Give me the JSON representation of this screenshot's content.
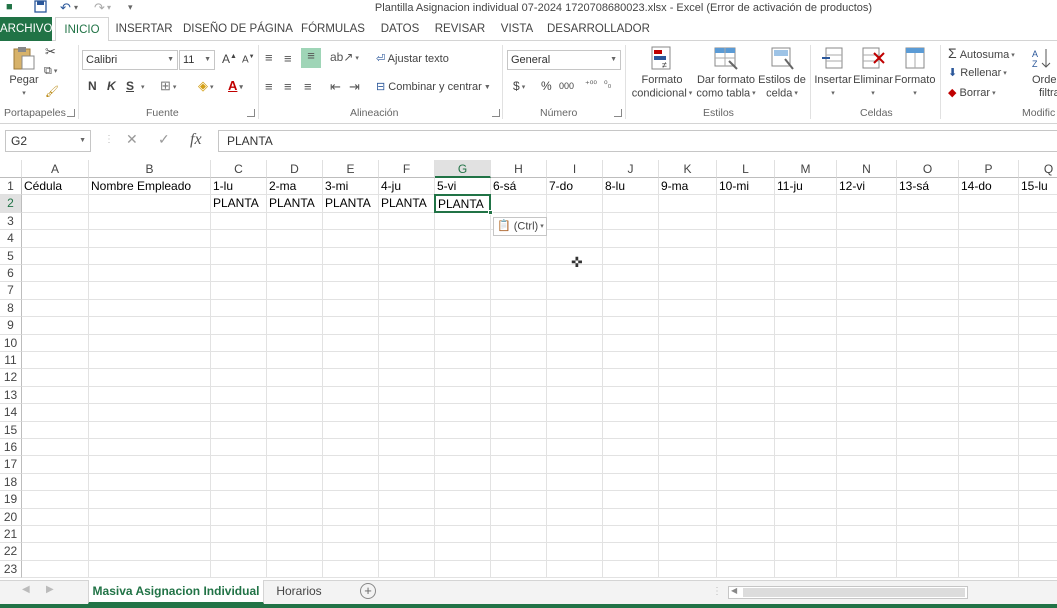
{
  "window": {
    "title": "Plantilla Asignacion individual 07-2024 1720708680023.xlsx - Excel (Error de activación de productos)"
  },
  "quick_access": {
    "save_icon": "save-icon",
    "undo_icon": "undo-icon",
    "redo_icon": "redo-icon",
    "customize_icon": "customize-icon"
  },
  "tabs": [
    "ARCHIVO",
    "INICIO",
    "INSERTAR",
    "DISEÑO DE PÁGINA",
    "FÓRMULAS",
    "DATOS",
    "REVISAR",
    "VISTA",
    "DESARROLLADOR"
  ],
  "ribbon": {
    "paste_label": "Pegar",
    "font_name": "Calibri",
    "font_size": "11",
    "bold": "N",
    "italic": "K",
    "underline": "S",
    "wrap_text": "Ajustar texto",
    "merge_center": "Combinar y centrar",
    "number_format": "General",
    "currency": "$",
    "percent": "%",
    "thousands": "000",
    "cond_format": [
      "Formato",
      "condicional"
    ],
    "format_table": [
      "Dar formato",
      "como tabla"
    ],
    "cell_styles": [
      "Estilos de",
      "celda"
    ],
    "insert": "Insertar",
    "delete": "Eliminar",
    "format": "Formato",
    "autosum": "Autosuma",
    "fill": "Rellenar",
    "clear": "Borrar",
    "sort_partial": [
      "Orden",
      "filtra"
    ],
    "groups": {
      "clipboard": "Portapapeles",
      "font": "Fuente",
      "alignment": "Alineación",
      "number": "Número",
      "styles": "Estilos",
      "cells": "Celdas",
      "modify": "Modific"
    }
  },
  "formula_bar": {
    "name_box": "G2",
    "fx": "fx",
    "value": "PLANTA"
  },
  "grid": {
    "columns": [
      "A",
      "B",
      "C",
      "D",
      "E",
      "F",
      "G",
      "H",
      "I",
      "J",
      "K",
      "L",
      "M",
      "N",
      "O",
      "P",
      "Q"
    ],
    "selected_column": "G",
    "rows": [
      "1",
      "2",
      "3",
      "4",
      "5",
      "6",
      "7",
      "8",
      "9",
      "10",
      "11",
      "12",
      "13",
      "14",
      "15",
      "16",
      "17",
      "18",
      "19",
      "20",
      "21",
      "22",
      "23"
    ],
    "selected_row": "2",
    "row1": [
      "Cédula",
      "Nombre Empleado",
      "1-lu",
      "2-ma",
      "3-mi",
      "4-ju",
      "5-vi",
      "6-sá",
      "7-do",
      "8-lu",
      "9-ma",
      "10-mi",
      "11-ju",
      "12-vi",
      "13-sá",
      "14-do",
      "15-lu"
    ],
    "row2": [
      "",
      "",
      "PLANTA",
      "PLANTA",
      "PLANTA",
      "PLANTA",
      "PLANTA",
      "",
      "",
      "",
      "",
      "",
      "",
      "",
      "",
      "",
      ""
    ],
    "active_cell": "G2"
  },
  "paste_options": {
    "label": "(Ctrl)"
  },
  "sheets": {
    "tabs": [
      "Masiva Asignacion Individual",
      "Horarios"
    ],
    "active": "Masiva Asignacion Individual",
    "add_icon": "add-sheet-icon"
  },
  "colors": {
    "accent": "#217346"
  }
}
